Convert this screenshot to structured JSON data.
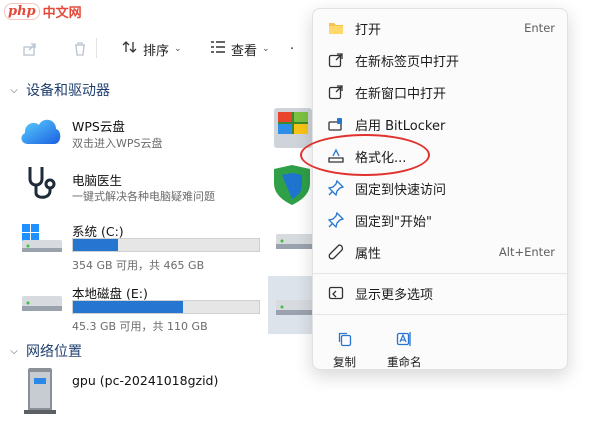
{
  "watermark": {
    "logo": "php",
    "text": "中文网"
  },
  "toolbar": {
    "sort_label": "排序",
    "view_label": "查看",
    "more_label": "·"
  },
  "sections": {
    "devices": "设备和驱动器",
    "network": "网络位置"
  },
  "devices": [
    {
      "name": "WPS云盘",
      "sub": "双击进入WPS云盘",
      "icon": "cloud-icon"
    },
    {
      "name": "电脑医生",
      "sub": "一键式解决各种电脑疑难问题",
      "icon": "stethoscope-icon"
    },
    {
      "name": "系统 (C:)",
      "sub": "354 GB 可用，共 465 GB",
      "used_fraction": 0.24,
      "icon": "drive-icon"
    },
    {
      "name": "本地磁盘 (E:)",
      "sub": "45.3 GB 可用，共 110 GB",
      "used_fraction": 0.59,
      "icon": "drive-icon"
    }
  ],
  "network": [
    {
      "name": "gpu (pc-20241018gzid)",
      "icon": "network-drive-icon"
    }
  ],
  "context_menu": {
    "items": [
      {
        "label": "打开",
        "shortcut": "Enter",
        "icon": "folder-icon"
      },
      {
        "label": "在新标签页中打开",
        "shortcut": "",
        "icon": "new-tab-icon"
      },
      {
        "label": "在新窗口中打开",
        "shortcut": "",
        "icon": "new-window-icon"
      },
      {
        "label": "启用 BitLocker",
        "shortcut": "",
        "icon": "bitlocker-icon"
      },
      {
        "label": "格式化...",
        "shortcut": "",
        "icon": "format-icon"
      },
      {
        "label": "固定到快速访问",
        "shortcut": "",
        "icon": "pin-icon"
      },
      {
        "label": "固定到\"开始\"",
        "shortcut": "",
        "icon": "pin-start-icon"
      },
      {
        "label": "属性",
        "shortcut": "Alt+Enter",
        "icon": "wrench-icon"
      },
      {
        "label": "显示更多选项",
        "shortcut": "",
        "icon": "more-options-icon"
      }
    ],
    "quick_actions": [
      {
        "label": "复制",
        "icon": "copy-icon"
      },
      {
        "label": "重命名",
        "icon": "rename-icon"
      }
    ]
  },
  "colors": {
    "accent": "#2676d1",
    "highlight_circle": "#e0322e"
  }
}
